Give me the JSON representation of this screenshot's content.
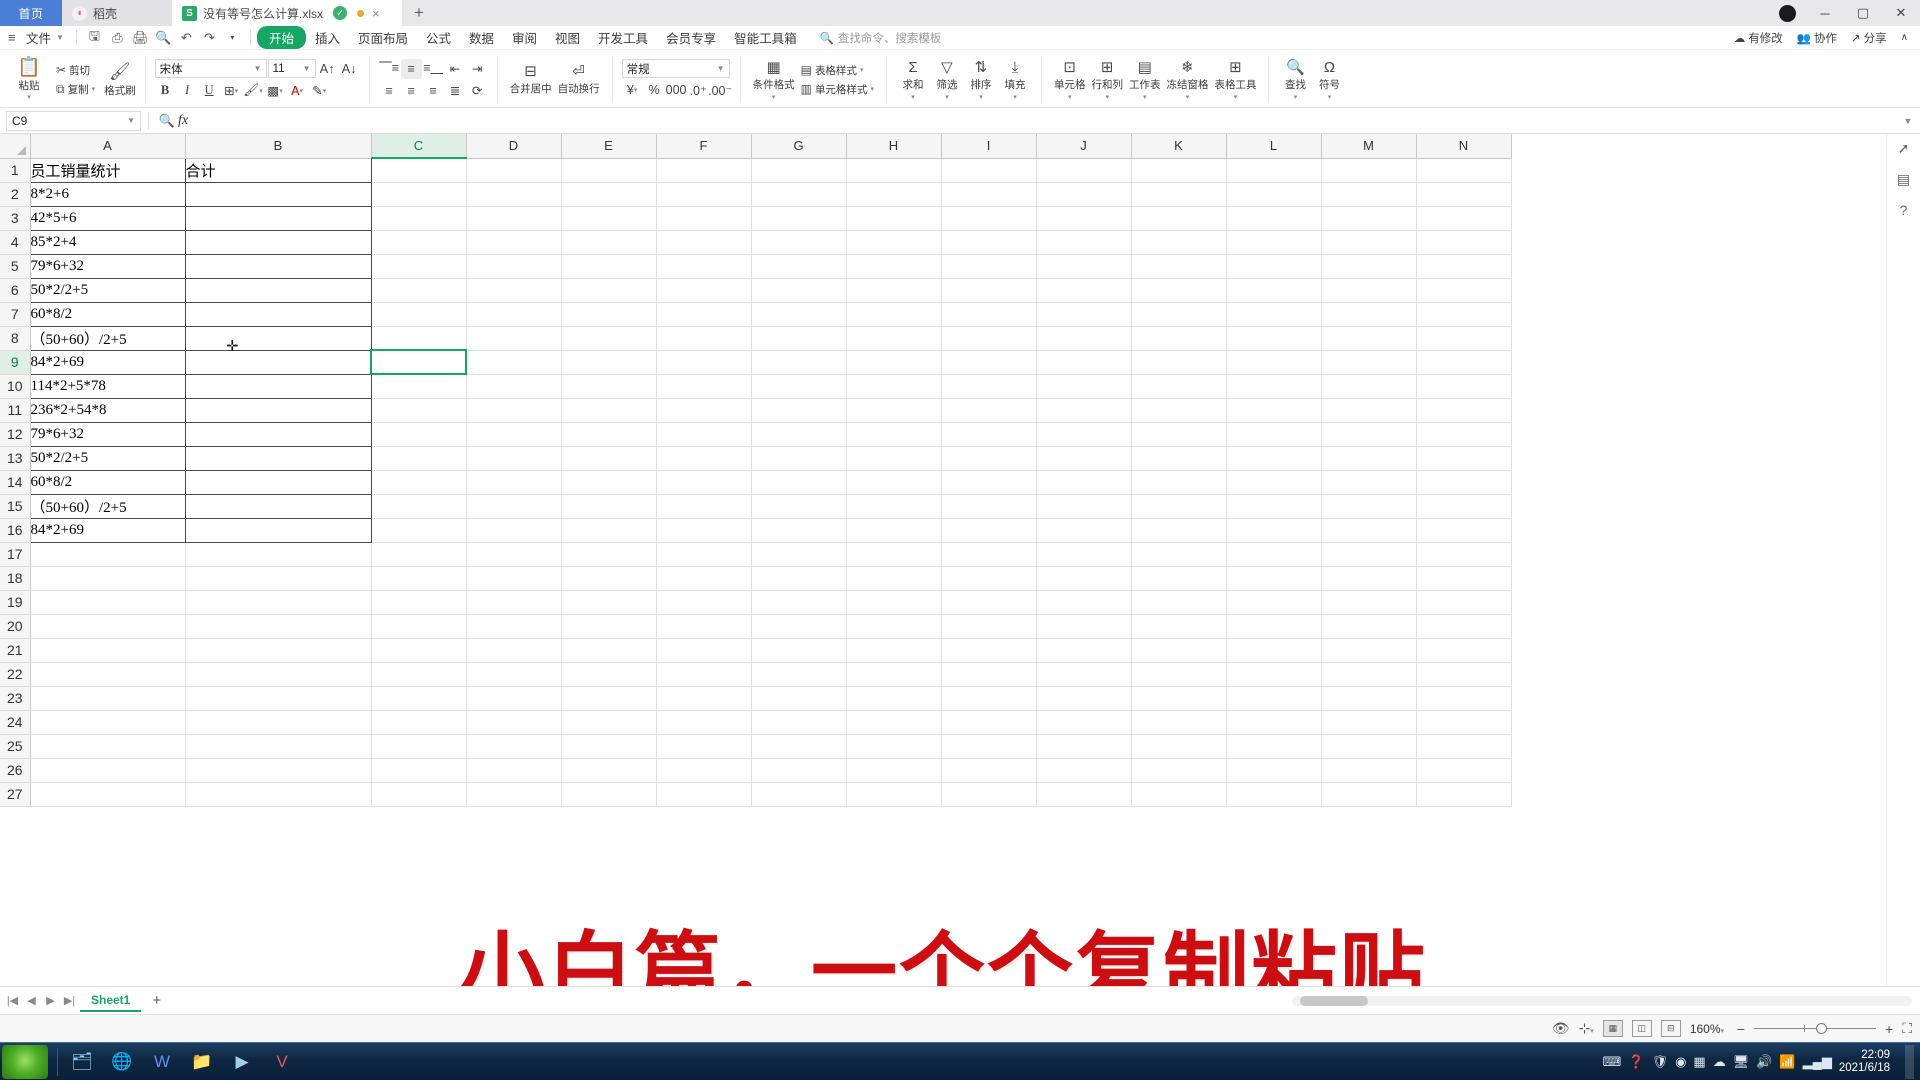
{
  "tabbar": {
    "home_label": "首页",
    "tabs": [
      {
        "name": "稻壳",
        "icon": "rice-husk-icon",
        "state": "inactive"
      },
      {
        "name": "没有等号怎么计算.xlsx",
        "icon": "xlsx-icon",
        "state": "active"
      }
    ],
    "new_tab_label": "+",
    "window_controls": [
      "minimize",
      "maximize",
      "close"
    ]
  },
  "menubar": {
    "file_label": "文件",
    "quick_access": [
      "save-icon",
      "print-preview-icon",
      "print-icon",
      "print-search-icon",
      "undo-icon",
      "redo-icon",
      "customize-icon"
    ],
    "tabs": [
      {
        "label": "开始",
        "active": true
      },
      {
        "label": "插入",
        "active": false
      },
      {
        "label": "页面布局",
        "active": false
      },
      {
        "label": "公式",
        "active": false
      },
      {
        "label": "数据",
        "active": false
      },
      {
        "label": "审阅",
        "active": false
      },
      {
        "label": "视图",
        "active": false
      },
      {
        "label": "开发工具",
        "active": false
      },
      {
        "label": "会员专享",
        "active": false
      },
      {
        "label": "智能工具箱",
        "active": false
      }
    ],
    "search_placeholder": "查找命令、搜索模板",
    "right_items": [
      {
        "label": "有修改",
        "icon": "cloud-edit-icon"
      },
      {
        "label": "协作",
        "icon": "collaborate-icon"
      },
      {
        "label": "分享",
        "icon": "share-icon"
      }
    ],
    "collapse_icon": "chevron-up-icon"
  },
  "ribbon": {
    "paste_label": "粘贴",
    "cut_label": "剪切",
    "copy_label": "复制",
    "format_painter_label": "格式刷",
    "font_name": "宋体",
    "font_size": "11",
    "bold": "B",
    "italic": "I",
    "underline": "U",
    "merge_label": "合并居中",
    "wrap_label": "自动换行",
    "number_format": "常规",
    "conditional_format_label": "条件格式",
    "cell_style_label": "单元格样式",
    "table_style_label": "表格样式",
    "sum_label": "求和",
    "filter_label": "筛选",
    "sort_label": "排序",
    "fill_label": "填充",
    "cells_label": "单元格",
    "rowcol_label": "行和列",
    "worksheet_label": "工作表",
    "freeze_label": "冻结窗格",
    "table_tool_label": "表格工具",
    "find_label": "查找",
    "symbol_label": "符号"
  },
  "formula_bar": {
    "name_box": "C9",
    "search_icon": "magnifier-icon",
    "fx_label": "fx",
    "value": ""
  },
  "sheet": {
    "columns": [
      "A",
      "B",
      "C",
      "D",
      "E",
      "F",
      "G",
      "H",
      "I",
      "J",
      "K",
      "L",
      "M",
      "N"
    ],
    "selected_column": "C",
    "selected_row": 9,
    "selected_cell": "C9",
    "row_count": 27,
    "col_a_header": "员工销量统计",
    "col_b_header": "合计",
    "rows": [
      {
        "n": 1,
        "a": "员工销量统计",
        "b": "合计"
      },
      {
        "n": 2,
        "a": "8*2+6",
        "b": ""
      },
      {
        "n": 3,
        "a": "42*5+6",
        "b": ""
      },
      {
        "n": 4,
        "a": "85*2+4",
        "b": ""
      },
      {
        "n": 5,
        "a": "79*6+32",
        "b": ""
      },
      {
        "n": 6,
        "a": "50*2/2+5",
        "b": ""
      },
      {
        "n": 7,
        "a": "60*8/2",
        "b": ""
      },
      {
        "n": 8,
        "a": "（50+60）/2+5",
        "b": ""
      },
      {
        "n": 9,
        "a": "84*2+69",
        "b": ""
      },
      {
        "n": 10,
        "a": "114*2+5*78",
        "b": ""
      },
      {
        "n": 11,
        "a": "236*2+54*8",
        "b": ""
      },
      {
        "n": 12,
        "a": "79*6+32",
        "b": ""
      },
      {
        "n": 13,
        "a": "50*2/2+5",
        "b": ""
      },
      {
        "n": 14,
        "a": "60*8/2",
        "b": ""
      },
      {
        "n": 15,
        "a": "（50+60）/2+5",
        "b": ""
      },
      {
        "n": 16,
        "a": "84*2+69",
        "b": ""
      },
      {
        "n": 17,
        "a": "",
        "b": ""
      },
      {
        "n": 18,
        "a": "",
        "b": ""
      },
      {
        "n": 19,
        "a": "",
        "b": ""
      },
      {
        "n": 20,
        "a": "",
        "b": ""
      },
      {
        "n": 21,
        "a": "",
        "b": ""
      },
      {
        "n": 22,
        "a": "",
        "b": ""
      },
      {
        "n": 23,
        "a": "",
        "b": ""
      },
      {
        "n": 24,
        "a": "",
        "b": ""
      },
      {
        "n": 25,
        "a": "",
        "b": ""
      },
      {
        "n": 26,
        "a": "",
        "b": ""
      },
      {
        "n": 27,
        "a": "",
        "b": ""
      }
    ]
  },
  "overlay": {
    "caption": "小白篇，一个个复制粘贴",
    "color": "#cc0d12"
  },
  "sheet_tabs": {
    "sheets": [
      {
        "name": "Sheet1",
        "active": true
      }
    ],
    "add_label": "+"
  },
  "statusbar": {
    "zoom": "160%",
    "zoom_out": "−",
    "zoom_in": "+",
    "view_icons": [
      "normal-view-icon",
      "page-layout-icon",
      "page-break-icon"
    ],
    "eye_icon": "eye-icon",
    "scale_icon": "scale-icon",
    "fullscreen_icon": "fullscreen-icon"
  },
  "taskbar": {
    "clock_time": "22:09",
    "clock_date": "2021/6/18",
    "apps": [
      "file-explorer-icon",
      "ie-icon",
      "wps-icon",
      "folder-icon",
      "media-icon",
      "video-icon"
    ],
    "tray": [
      "keyboard-icon",
      "help-icon",
      "shield-icon",
      "chrome-icon",
      "apps-icon",
      "cloud-icon",
      "monitor-icon",
      "volume-icon",
      "network-icon",
      "signal-icon",
      "battery-icon"
    ]
  },
  "colors": {
    "accent_green": "#17a765",
    "tab_blue": "#4b7fd6",
    "overlay_red": "#cc0d12"
  }
}
